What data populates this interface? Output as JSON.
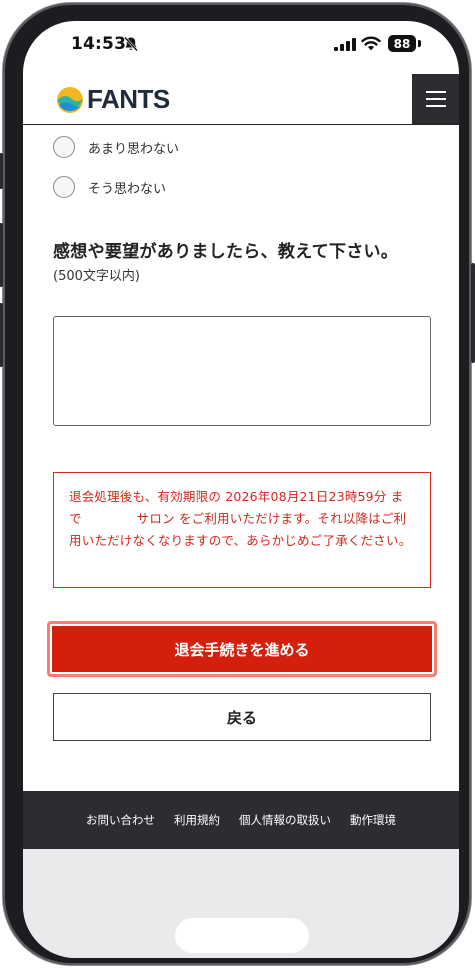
{
  "status_bar": {
    "time": "14:53",
    "battery": "88"
  },
  "header": {
    "logo_text": "FANTS"
  },
  "survey": {
    "options": [
      {
        "label": "あまり思わない"
      },
      {
        "label": "そう思わない"
      }
    ],
    "question": "感想や要望がありましたら、教えて下さい。",
    "question_note": "(500文字以内)",
    "feedback_value": ""
  },
  "notice": {
    "text": "退会処理後も、有効期限の 2026年08月21日23時59分 まで　　　　 サロン をご利用いただけます。それ以降はご利用いただけなくなりますので、あらかじめご了承ください。"
  },
  "actions": {
    "proceed_label": "退会手続きを進める",
    "back_label": "戻る"
  },
  "footer": {
    "links": [
      "お問い合わせ",
      "利用規約",
      "個人情報の取扱い",
      "動作環境"
    ]
  },
  "colors": {
    "accent_red": "#d31f0c",
    "notice_red": "#d0281d",
    "dark": "#2b2d31"
  }
}
